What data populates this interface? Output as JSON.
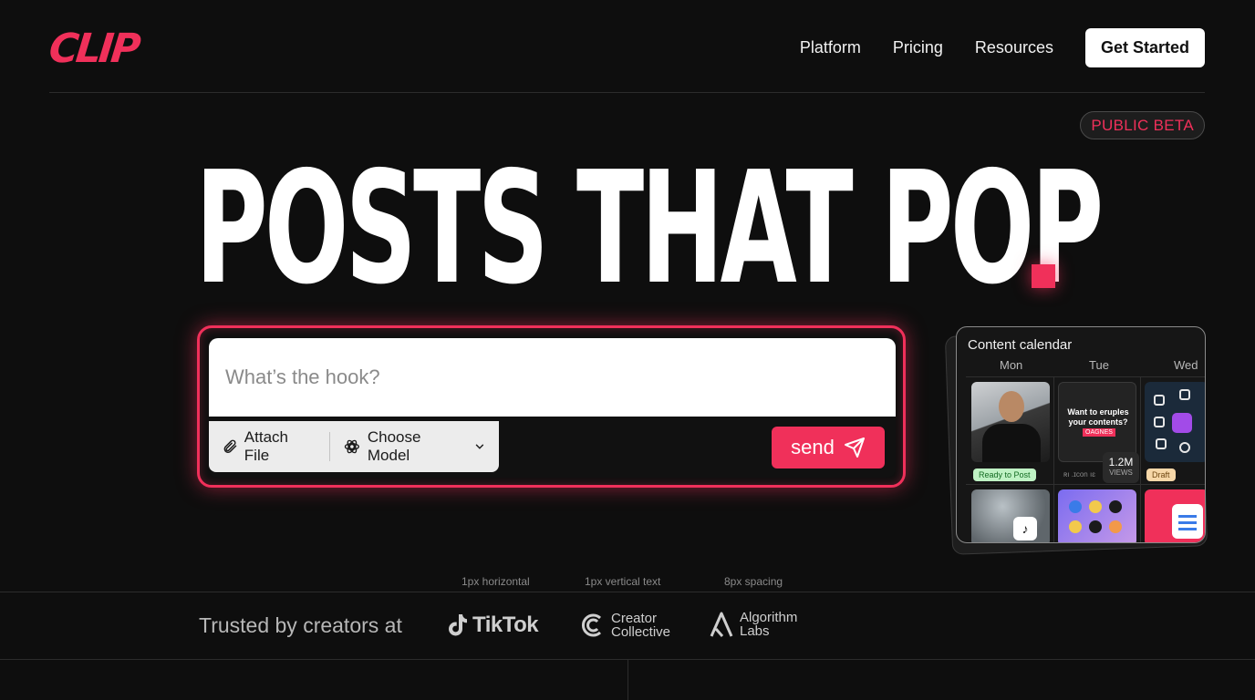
{
  "nav": {
    "logo": "CLIP",
    "links": [
      "Platform",
      "Pricing",
      "Resources"
    ],
    "cta": "Get Started"
  },
  "hero": {
    "badge": "PUBLIC BETA",
    "headline": "POSTS THAT POP"
  },
  "prompt": {
    "placeholder": "What’s the hook?",
    "attach_label": "Attach File",
    "model_label": "Choose Model",
    "send_label": "send"
  },
  "calendar": {
    "title": "Content calendar",
    "days": [
      "Mon",
      "Tue",
      "Wed"
    ],
    "tile_hook_text": "Want to eruples your contents?",
    "tile_hook_tag": "OAGNES",
    "views_value": "1.2M",
    "views_label": "VIEWS",
    "status_ready": "Ready to Post",
    "status_draft": "Draft",
    "meta_text": "ʀı .ɪcon ıɛ"
  },
  "annotations": [
    "1px horizontal",
    "1px vertical text",
    "8px spacing"
  ],
  "trust": {
    "label": "Trusted by creators at",
    "brands": [
      {
        "name": "TikTok",
        "icon": "tiktok-icon"
      },
      {
        "line1": "Creator",
        "line2": "Collective",
        "icon": "creator-collective-icon"
      },
      {
        "line1": "Algorithm",
        "line2": "Labs",
        "icon": "algorithm-labs-icon"
      }
    ]
  },
  "colors": {
    "accent": "#f0305a",
    "background": "#0e0e0e"
  }
}
